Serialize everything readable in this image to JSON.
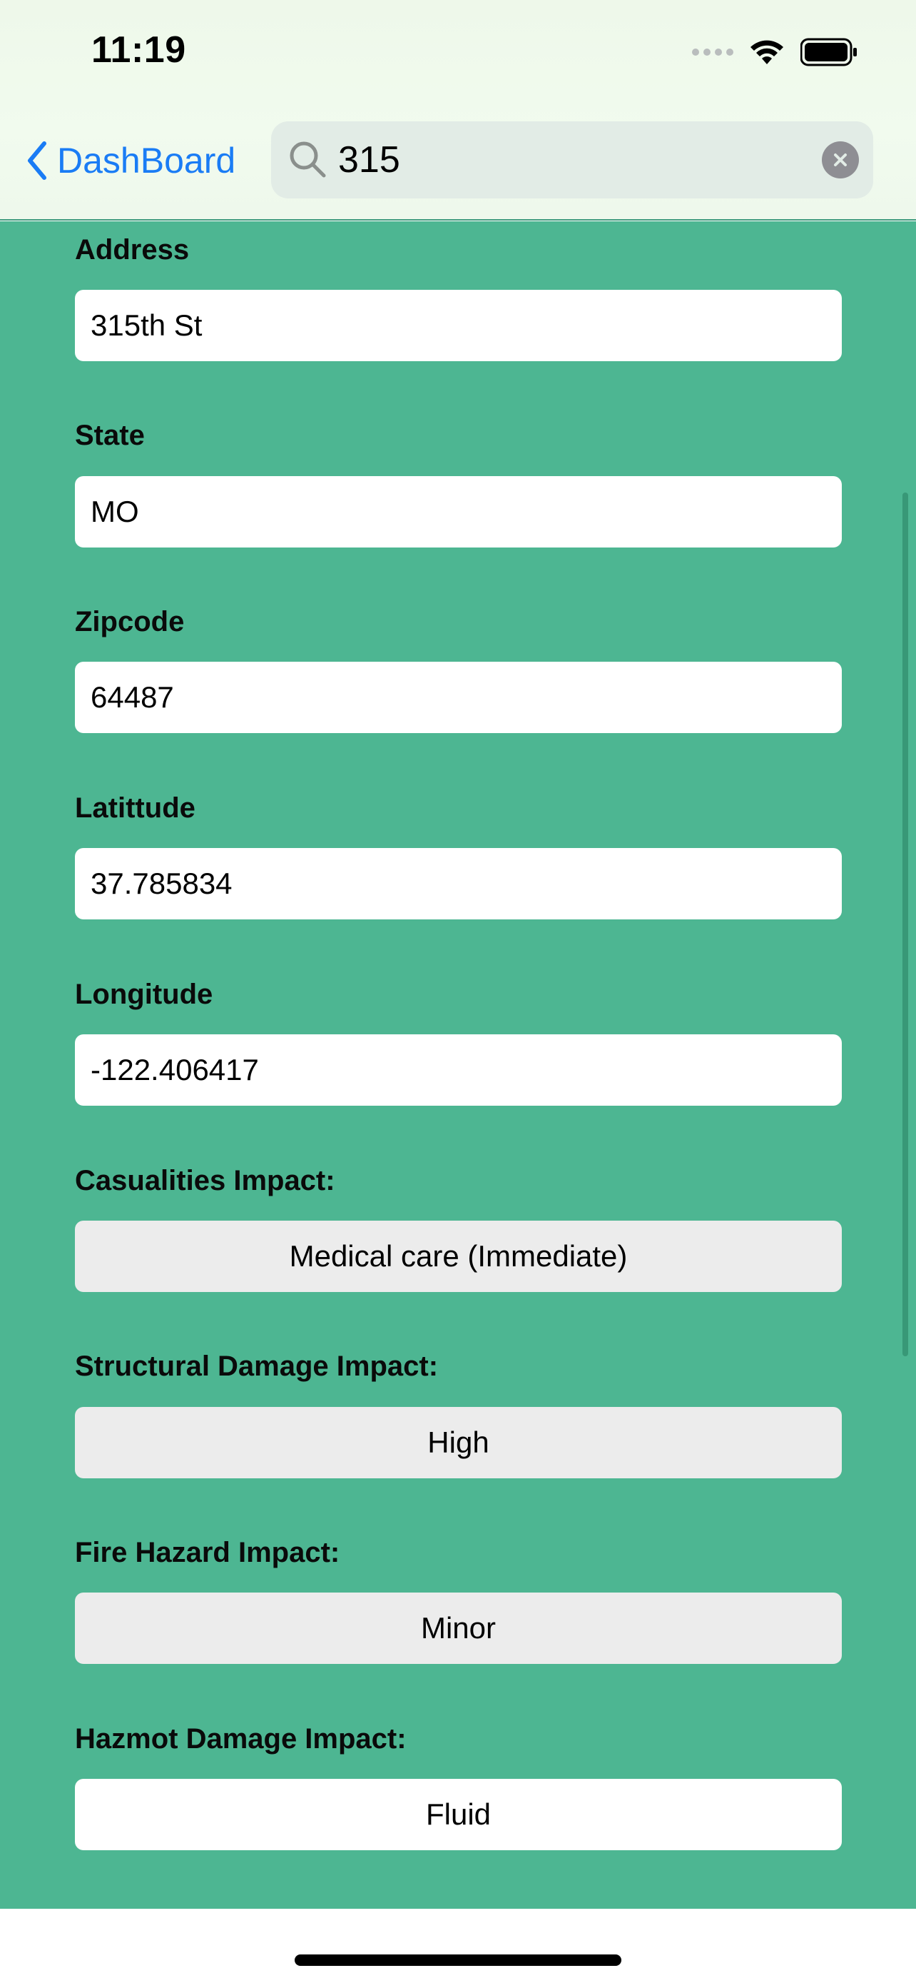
{
  "status_bar": {
    "time": "11:19"
  },
  "nav": {
    "back_label": "DashBoard",
    "search_value": "315"
  },
  "form": {
    "address_label": "Address",
    "address_value": "315th St",
    "state_label": "State",
    "state_value": "MO",
    "zipcode_label": "Zipcode",
    "zipcode_value": "64487",
    "latitude_label": "Latittude",
    "latitude_value": "37.785834",
    "longitude_label": "Longitude",
    "longitude_value": "-122.406417",
    "casualties_label": "Casualities Impact:",
    "casualties_value": "Medical care (Immediate)",
    "structural_label": "Structural Damage Impact:",
    "structural_value": "High",
    "fire_label": "Fire Hazard Impact:",
    "fire_value": "Minor",
    "hazmat_label": "Hazmot Damage Impact:",
    "hazmat_value": "Fluid"
  },
  "colors": {
    "background": "#4db692",
    "accent": "#1a7cf5"
  }
}
